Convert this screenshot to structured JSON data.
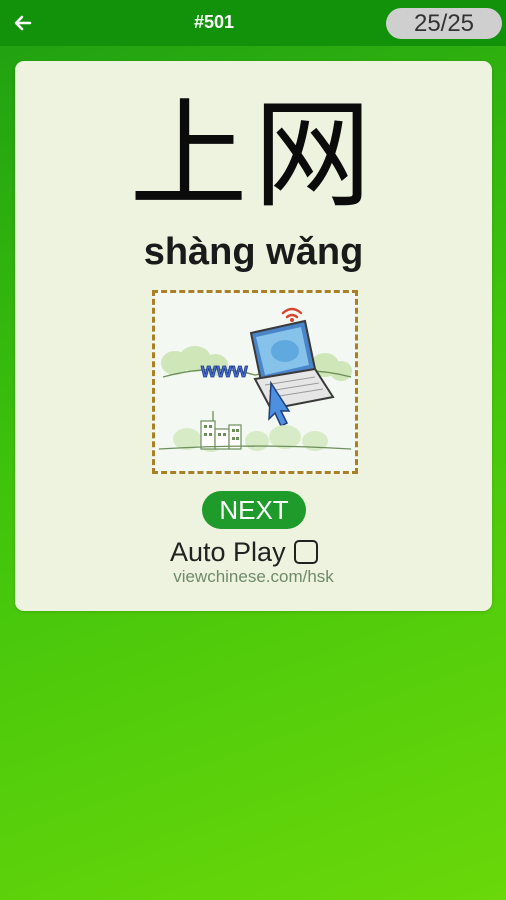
{
  "header": {
    "back_icon": "arrow-left-icon",
    "title": "#501",
    "counter": "25/25"
  },
  "card": {
    "hanzi": "上网",
    "pinyin": "shàng wǎng",
    "illustration_icon": "laptop-www-cursor-illustration",
    "illustration_text": "www",
    "next_label": "NEXT",
    "autoplay_label": "Auto Play",
    "autoplay_checked": false,
    "site": "viewchinese.com/hsk"
  },
  "colors": {
    "topbar": "#11920a",
    "card": "#eef3df",
    "next_button": "#1f9b2c",
    "counter_pill": "#cfcfcf"
  }
}
